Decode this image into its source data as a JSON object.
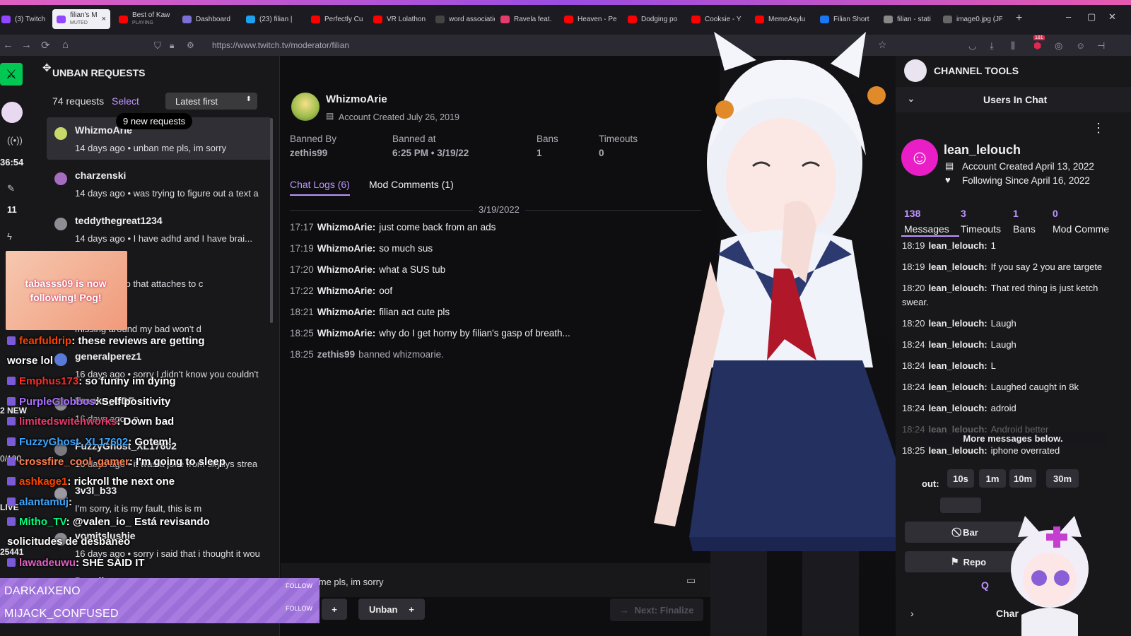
{
  "browser": {
    "tabs": [
      {
        "label": "(3) Twitch",
        "color": "#9146ff"
      },
      {
        "label": "filian's M",
        "sub": "MUTED",
        "color": "#9146ff",
        "active": true
      },
      {
        "label": "Best of Kaw",
        "sub": "PLAYING",
        "color": "#ff0000"
      },
      {
        "label": "Dashboard",
        "color": "#7b6fd6"
      },
      {
        "label": "(23) filian |",
        "color": "#1da1f2"
      },
      {
        "label": "Perfectly Cu",
        "color": "#ff0000"
      },
      {
        "label": "VR Lolathon",
        "color": "#ff0000"
      },
      {
        "label": "word associatio",
        "color": "#444"
      },
      {
        "label": "Ravela feat.",
        "color": "#e53d6b"
      },
      {
        "label": "Heaven - Pe",
        "color": "#ff0000"
      },
      {
        "label": "Dodging po",
        "color": "#ff0000"
      },
      {
        "label": "Cooksie - Y",
        "color": "#ff0000"
      },
      {
        "label": "MemeAsylu",
        "color": "#ff0000"
      },
      {
        "label": "Filian Short",
        "color": "#1877f2"
      },
      {
        "label": "filian - stati",
        "color": "#888"
      },
      {
        "label": "image0.jpg (JPE",
        "color": "#666"
      }
    ],
    "new_tab": "+",
    "url": "https://www.twitch.tv/moderator/filian",
    "badge": "181"
  },
  "left_strip": {
    "timer": "36:54",
    "count": "11",
    "new_label": "2 NEW",
    "ratio": "0/100",
    "live": "LIVE",
    "views": "25441"
  },
  "unban": {
    "title": "UNBAN REQUESTS",
    "count": "74 requests",
    "select": "Select",
    "sort": "Latest first",
    "new_requests": "9 new requests",
    "requests": [
      {
        "name": "WhizmoArie",
        "line": "14 days ago • unban me pls, im sorry"
      },
      {
        "name": "charzenski",
        "line": "14 days ago • was trying to figure out a text a"
      },
      {
        "name": "teddythegreat1234",
        "line": "14 days ago • I have adhd and I have brai..."
      },
      {
        "name": "1",
        "line": "I have an app that attaches to c"
      },
      {
        "name": "",
        "line": "missing around my bad won't d"
      },
      {
        "name": "generalperez1",
        "line": "16 days ago • sorry I didn't know you couldn't"
      },
      {
        "name": "Franko_GDF",
        "line": "16 days ago • n"
      },
      {
        "name": "FuzzyGhost_XL17602",
        "line": "16 days ago • it was a joke from skyllys strea"
      },
      {
        "name": "3v3l_b33",
        "line": "I'm sorry, it is my fault, this is m"
      },
      {
        "name": "vomitslushie",
        "line": "16 days ago • sorry i said that i thought it wou"
      },
      {
        "name": "Devalicy",
        "line": ""
      }
    ]
  },
  "detail": {
    "username": "WhizmoArie",
    "created": "Account Created July 26, 2019",
    "stats": [
      {
        "label": "Banned By",
        "value": "zethis99"
      },
      {
        "label": "Banned at",
        "value": "6:25 PM • 3/19/22"
      },
      {
        "label": "Bans",
        "value": "1"
      },
      {
        "label": "Timeouts",
        "value": "0"
      }
    ],
    "tabs": [
      "Chat Logs (6)",
      "Mod Comments (1)"
    ],
    "date": "3/19/2022",
    "logs": [
      {
        "time": "17:17",
        "user": "WhizmoArie:",
        "msg": "just come back from an ads"
      },
      {
        "time": "17:19",
        "user": "WhizmoArie:",
        "msg": "so much sus"
      },
      {
        "time": "17:20",
        "user": "WhizmoArie:",
        "msg": "what a SUS tub"
      },
      {
        "time": "17:22",
        "user": "WhizmoArie:",
        "msg": "oof"
      },
      {
        "time": "18:21",
        "user": "WhizmoArie:",
        "msg": "filian act cute pls"
      },
      {
        "time": "18:25",
        "user": "WhizmoArie:",
        "msg": "why do I get horny by filian's gasp of breath..."
      },
      {
        "time": "18:25",
        "user": "zethis99",
        "msg": "banned whizmoarie."
      }
    ],
    "request_text": "unban me pls, im sorry",
    "unban_label": "Unban",
    "next_label": "Next: Finalize"
  },
  "channel_tools": {
    "title": "CHANNEL TOOLS",
    "users_in_chat": "Users In Chat",
    "username": "lean_lelouch",
    "created": "Account Created April 13, 2022",
    "following": "Following Since April 16, 2022",
    "stats": [
      {
        "value": "138",
        "label": "Messages"
      },
      {
        "value": "3",
        "label": "Timeouts"
      },
      {
        "value": "1",
        "label": "Bans"
      },
      {
        "value": "0",
        "label": "Mod Comme"
      }
    ],
    "messages": [
      {
        "time": "18:19",
        "user": "lean_lelouch:",
        "msg": "1"
      },
      {
        "time": "18:19",
        "user": "lean_lelouch:",
        "msg": "If you say 2 you are targete"
      },
      {
        "time": "18:20",
        "user": "lean_lelouch:",
        "msg": "That red thing is just ketch"
      },
      {
        "time": "",
        "user": "",
        "msg": "swear."
      },
      {
        "time": "18:20",
        "user": "lean_lelouch:",
        "msg": "Laugh"
      },
      {
        "time": "18:24",
        "user": "lean_lelouch:",
        "msg": "Laugh"
      },
      {
        "time": "18:24",
        "user": "lean_lelouch:",
        "msg": "L"
      },
      {
        "time": "18:24",
        "user": "lean_lelouch:",
        "msg": "Laughed caught in 8k"
      },
      {
        "time": "18:24",
        "user": "lean_lelouch:",
        "msg": "adroid"
      },
      {
        "time": "18:24",
        "user": "lean_lelouch:",
        "msg": "Android better"
      },
      {
        "time": "18:25",
        "user": "lean_lelouch:",
        "msg": "iphone overrated"
      }
    ],
    "more_below": "More messages below.",
    "timeout_label": "out:",
    "timeouts": [
      "10s",
      "1m",
      "10m",
      "30m"
    ],
    "ban_label": "Bar",
    "report_label": "Repo",
    "q_label": "Q",
    "chan_label": "Char"
  },
  "overlay": {
    "follow_alert": "tabasss09 is now following! Pog!",
    "chat": [
      {
        "user": "fearfuldrip",
        "color": "#ff4500",
        "msg": "these reviews are getting"
      },
      {
        "user": "",
        "color": "#fff",
        "msg": "worse lol"
      },
      {
        "user": "Emphus173",
        "color": "#ff2b2b",
        "msg": "so funny  im dying"
      },
      {
        "user": "PurpleGlobbos",
        "color": "#a970ff",
        "msg": "Self positivity"
      },
      {
        "user": "limitedswitchworks",
        "color": "#e53d6b",
        "msg": "Down bad"
      },
      {
        "user": "FuzzyGhost_XL17602",
        "color": "#3ea6ff",
        "msg": "Gotem!"
      },
      {
        "user": "crossfire_cool_gamer",
        "color": "#ff7f50",
        "msg": "I'm going to sleep"
      },
      {
        "user": "ashkage1",
        "color": "#ff4500",
        "msg": "rickroll the next one"
      },
      {
        "user": "alantamuj",
        "color": "#3ea6ff",
        "msg": ""
      },
      {
        "user": "Mitho_TV",
        "color": "#00ff7f",
        "msg": "@valen_io_ Está revisando"
      },
      {
        "user": "",
        "color": "#fff",
        "msg": "solicitudes de desbaneo"
      },
      {
        "user": "lawadeuwu",
        "color": "#e060c0",
        "msg": "SHE SAID IT"
      }
    ],
    "alerts": [
      {
        "name": "DARKAIXENO",
        "action": "FOLLOW"
      },
      {
        "name": "MIJACK_CONFUSED",
        "action": "FOLLOW"
      }
    ]
  },
  "colors": {
    "accent": "#a970ff",
    "bg": "#0e0e10",
    "panel": "#18181b",
    "follow_bar": "#a77be0"
  }
}
